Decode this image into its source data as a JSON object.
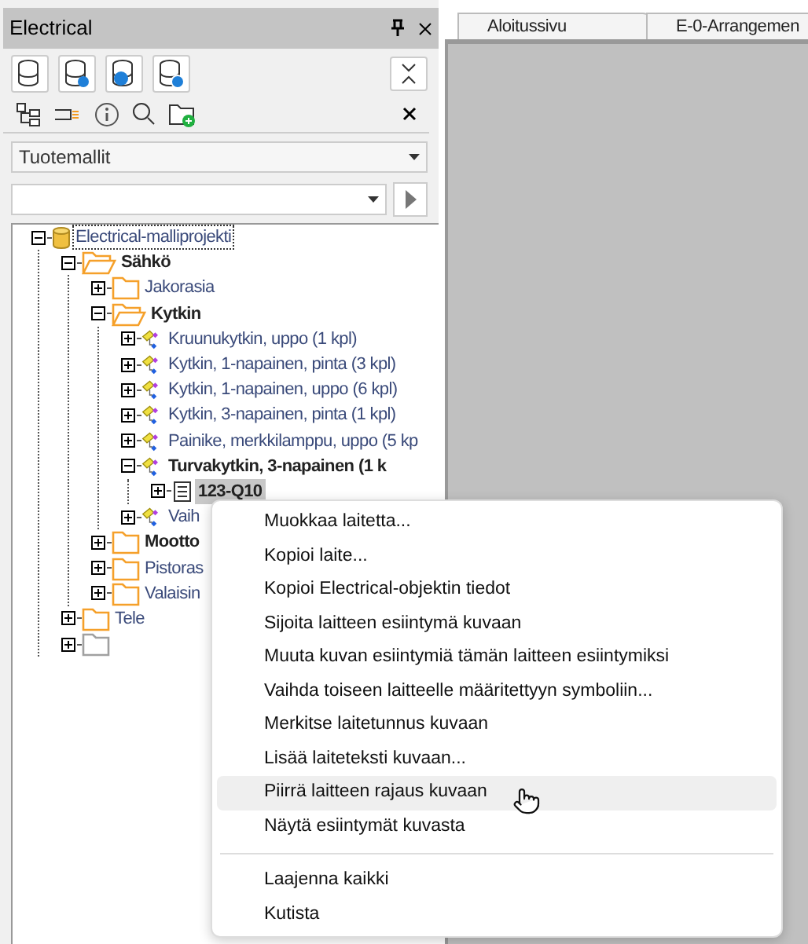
{
  "panel": {
    "title": "Electrical"
  },
  "view_select": {
    "value": "Tuotemallit"
  },
  "tabs": [
    {
      "label": "Aloitussivu"
    },
    {
      "label": "E-0-Arrangemen"
    }
  ],
  "tree": [
    {
      "kind": "project",
      "label": "Electrical-malliprojekti",
      "expanded": true,
      "emphasized": false,
      "focused": true,
      "selected": false,
      "children": [
        {
          "kind": "folder",
          "color": "#f5a02a",
          "label": "Sähkö",
          "expanded": true,
          "emphasized": true,
          "focused": false,
          "selected": false,
          "children": [
            {
              "kind": "folder",
              "color": "#f5a02a",
              "label": "Jakorasia",
              "expanded": false,
              "emphasized": false,
              "focused": false,
              "selected": false
            },
            {
              "kind": "folder",
              "color": "#f5a02a",
              "label": "Kytkin",
              "expanded": true,
              "emphasized": true,
              "focused": false,
              "selected": false,
              "children": [
                {
                  "kind": "device",
                  "label": "Kruunukytkin, uppo (1 kpl)",
                  "expanded": false,
                  "emphasized": false,
                  "focused": false,
                  "selected": false
                },
                {
                  "kind": "device",
                  "label": "Kytkin, 1-napainen, pinta (3 kpl)",
                  "expanded": false,
                  "emphasized": false,
                  "focused": false,
                  "selected": false
                },
                {
                  "kind": "device",
                  "label": "Kytkin, 1-napainen, uppo (6 kpl)",
                  "expanded": false,
                  "emphasized": false,
                  "focused": false,
                  "selected": false
                },
                {
                  "kind": "device",
                  "label": "Kytkin, 3-napainen, pinta (1 kpl)",
                  "expanded": false,
                  "emphasized": false,
                  "focused": false,
                  "selected": false
                },
                {
                  "kind": "device",
                  "label": "Painike, merkkilamppu, uppo (5 kp",
                  "expanded": false,
                  "emphasized": false,
                  "focused": false,
                  "selected": false
                },
                {
                  "kind": "device",
                  "label": "Turvakytkin, 3-napainen (1 k",
                  "expanded": true,
                  "emphasized": true,
                  "focused": false,
                  "selected": false,
                  "children": [
                    {
                      "kind": "instance",
                      "label": "123-Q10",
                      "expanded": false,
                      "emphasized": true,
                      "focused": false,
                      "selected": true
                    }
                  ]
                },
                {
                  "kind": "device",
                  "label": "Vaih",
                  "expanded": false,
                  "emphasized": false,
                  "focused": false,
                  "selected": false
                }
              ]
            },
            {
              "kind": "folder",
              "color": "#f5a02a",
              "label": "Mootto",
              "expanded": false,
              "emphasized": true,
              "focused": false,
              "selected": false
            },
            {
              "kind": "folder",
              "color": "#f5a02a",
              "label": "Pistoras",
              "expanded": false,
              "emphasized": false,
              "focused": false,
              "selected": false
            },
            {
              "kind": "folder",
              "color": "#f5a02a",
              "label": "Valaisin",
              "expanded": false,
              "emphasized": false,
              "focused": false,
              "selected": false
            }
          ]
        },
        {
          "kind": "folder",
          "color": "#f5a02a",
          "label": "Tele",
          "expanded": false,
          "emphasized": false,
          "focused": false,
          "selected": false
        },
        {
          "kind": "folder",
          "color": "#a0a0a0",
          "expanded": false
        }
      ]
    }
  ],
  "context_menu": {
    "sections": [
      [
        {
          "label": "Muokkaa laitetta...",
          "hovered": false
        },
        {
          "label": "Kopioi laite...",
          "hovered": false
        },
        {
          "label": "Kopioi Electrical-objektin tiedot",
          "hovered": false
        },
        {
          "label": "Sijoita laitteen esiintymä kuvaan",
          "hovered": false
        },
        {
          "label": "Muuta kuvan esiintymiä tämän laitteen esiintymiksi",
          "hovered": false
        },
        {
          "label": "Vaihda toiseen laitteelle määritettyyn symboliin...",
          "hovered": false
        },
        {
          "label": "Merkitse laitetunnus kuvaan",
          "hovered": false
        },
        {
          "label": "Lisää laiteteksti kuvaan...",
          "hovered": false
        },
        {
          "label": "Piirrä laitteen rajaus kuvaan",
          "hovered": true
        },
        {
          "label": "Näytä esiintymät kuvasta",
          "hovered": false
        }
      ],
      [
        {
          "label": "Laajenna kaikki",
          "hovered": false
        },
        {
          "label": "Kutista",
          "hovered": false
        }
      ]
    ]
  }
}
